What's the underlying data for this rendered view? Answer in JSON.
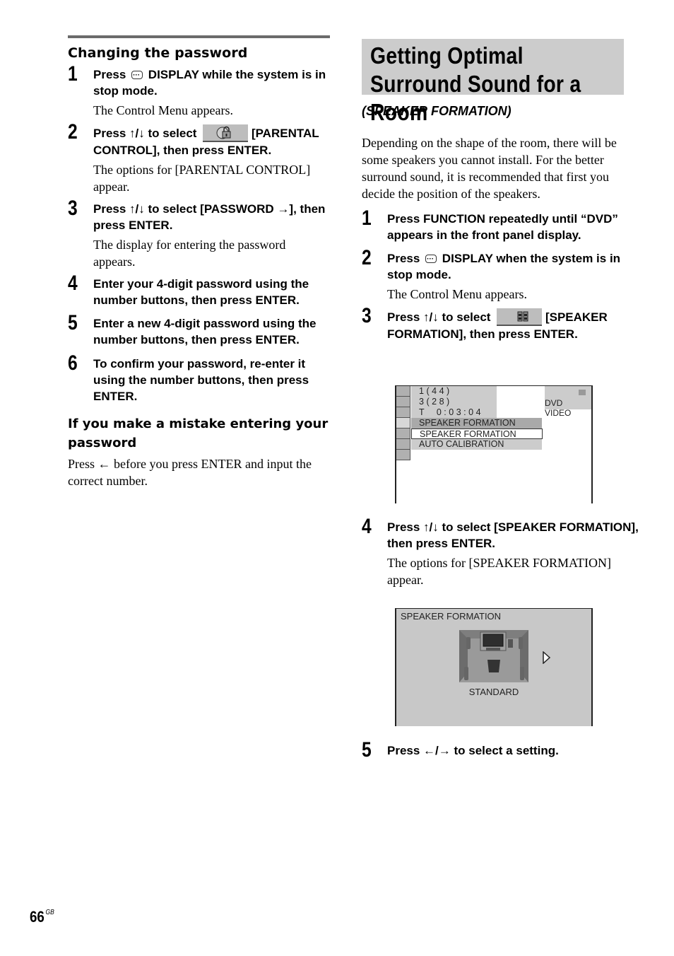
{
  "left": {
    "section_title": "Changing the password",
    "steps": [
      {
        "num": "1",
        "instr_a": "Press",
        "instr_b": "DISPLAY while the system is in stop mode.",
        "desc": "The Control Menu appears."
      },
      {
        "num": "2",
        "instr_a": "Press ↑/↓ to select",
        "instr_b": "[PARENTAL CONTROL], then press ENTER.",
        "desc": "The options for [PARENTAL CONTROL] appear."
      },
      {
        "num": "3",
        "instr": "Press ↑/↓ to select [PASSWORD →], then press ENTER.",
        "desc": "The display for entering the password appears."
      },
      {
        "num": "4",
        "instr": "Enter your 4-digit password using the number buttons, then press ENTER."
      },
      {
        "num": "5",
        "instr": "Enter a new 4-digit password using the number buttons, then press ENTER."
      },
      {
        "num": "6",
        "instr": "To confirm your password, re-enter it using the number buttons, then press ENTER."
      }
    ],
    "mistake_title": "If you make a mistake entering your password",
    "mistake_text": "Press ← before you press ENTER and input the correct number."
  },
  "right": {
    "title": "Getting Optimal Surround Sound for a Room",
    "subtitle": "(SPEAKER FORMATION)",
    "intro": "Depending on the shape of the room, there will be some speakers you cannot install. For the better surround sound, it is recommended that first you decide the position of the speakers.",
    "steps": [
      {
        "num": "1",
        "instr": "Press FUNCTION repeatedly until “DVD” appears in the front panel display."
      },
      {
        "num": "2",
        "instr_a": "Press",
        "instr_b": "DISPLAY when the system is in stop mode.",
        "desc": "The Control Menu appears."
      },
      {
        "num": "3",
        "instr_a": "Press ↑/↓ to select",
        "instr_b": "[SPEAKER FORMATION], then press ENTER."
      },
      {
        "num": "4",
        "instr": "Press ↑/↓ to select [SPEAKER FORMATION], then press ENTER.",
        "desc": "The options for [SPEAKER FORMATION] appear."
      },
      {
        "num": "5",
        "instr": "Press ←/→ to select a setting."
      }
    ],
    "osd1": {
      "info_lines": [
        "1(44)",
        "3(28)",
        "T  0:03:04"
      ],
      "highlighted": "SPEAKER FORMATION",
      "selected": "SPEAKER FORMATION",
      "option": "AUTO CALIBRATION",
      "media_label": "DVD VIDEO"
    },
    "osd2": {
      "header": "SPEAKER FORMATION",
      "setting": "STANDARD"
    }
  },
  "footer": {
    "page_number": "66",
    "region": "GB"
  }
}
